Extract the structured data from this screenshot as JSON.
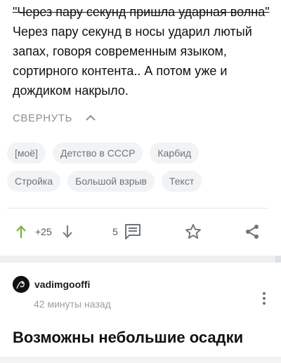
{
  "post": {
    "quote_line": "\"Через пару секунд пришла ударная волна\"",
    "body": "Через пару секунд  в носы ударил лютый запах, говоря современным языком, сортирного контента..  А потом уже и дождиком накрыло."
  },
  "collapse": {
    "label": "СВЕРНУТЬ",
    "icon": "chevron-up-icon"
  },
  "tags": {
    "row1": [
      "[моё]",
      "Детство в СССР",
      "Карбид"
    ],
    "row2": [
      "Стройка",
      "Большой взрыв",
      "Текст"
    ]
  },
  "actions": {
    "rating": "+25",
    "comments": "5",
    "upvote_color": "#7cb342",
    "icons": [
      "arrow-up-icon",
      "arrow-down-icon",
      "comment-icon",
      "star-icon",
      "share-icon"
    ]
  },
  "next_post": {
    "author": "vadimgooffi",
    "time": "42 минуты назад",
    "title": "Возможны небольшие осадки",
    "icons": [
      "avatar",
      "more-vertical-icon"
    ]
  }
}
